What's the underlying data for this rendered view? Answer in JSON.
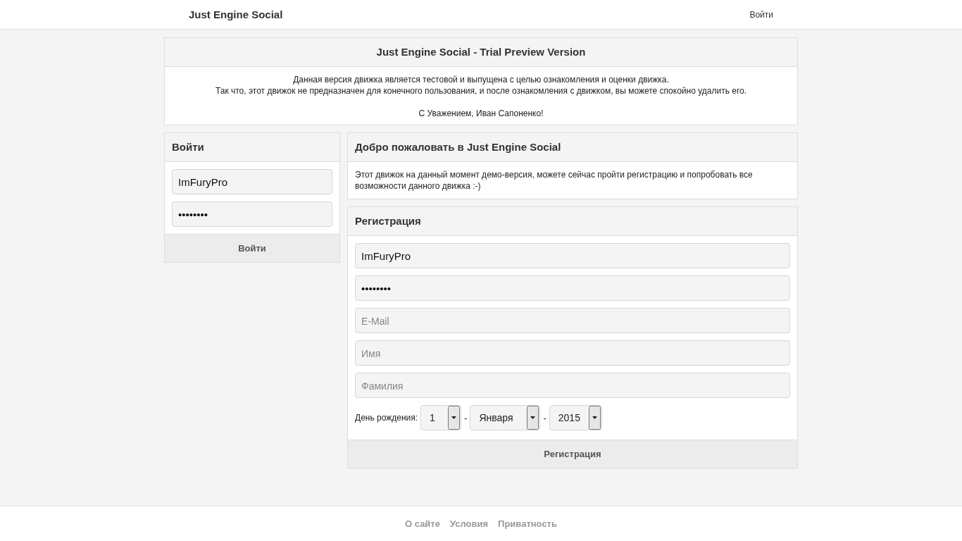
{
  "header": {
    "brand": "Just Engine Social",
    "login_link": "Войти"
  },
  "notice": {
    "title": "Just Engine Social - Trial Preview Version",
    "lines": [
      "Данная версия движка является тестовой и выпущена с целью ознакомления и оценки движка.",
      "Так что, этот движок не предназначен для конечного пользования, и после ознакомления с движком, вы можете спокойно удалить его."
    ],
    "signature": "С Уважением, Иван Сапоненко!"
  },
  "login": {
    "title": "Войти",
    "fields": [
      {
        "value": "ImFuryPro"
      },
      {
        "value": "••••••••"
      }
    ],
    "button": "Войти"
  },
  "welcome": {
    "title": "Добро пожаловать в Just Engine Social",
    "text": "Этот движок на данный момент демо-версия, можете сейчас пройти регистрацию и попробовать все возможности данного движка :-)"
  },
  "register": {
    "title": "Регистрация",
    "fields": [
      {
        "value": "ImFuryPro"
      },
      {
        "value": "••••••••"
      },
      {
        "placeholder": "E-Mail"
      },
      {
        "placeholder": "Имя"
      },
      {
        "placeholder": "Фамилия"
      }
    ],
    "birthday": {
      "label": "День рождения:",
      "separator": "-",
      "selects": [
        {
          "value": "1"
        },
        {
          "value": "Января"
        },
        {
          "value": "2015"
        }
      ]
    },
    "button": "Регистрация"
  },
  "footer": {
    "links": [
      "О сайте",
      "Условия",
      "Приватность"
    ]
  }
}
